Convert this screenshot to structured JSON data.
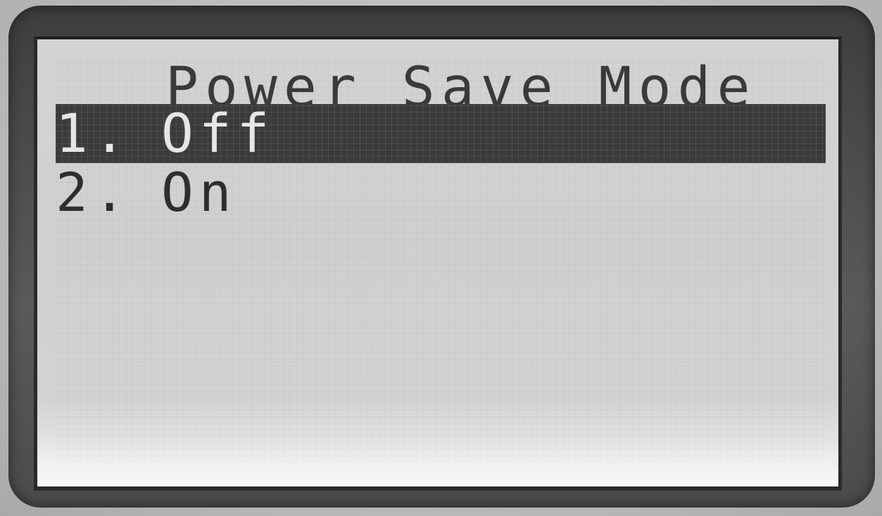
{
  "screen": {
    "title": "Power Save Mode",
    "menu": {
      "items": [
        {
          "number": "1.",
          "label": "Off",
          "selected": true
        },
        {
          "number": "2.",
          "label": "On",
          "selected": false
        }
      ]
    }
  },
  "colors": {
    "lcd_background": "#d2d2d2",
    "lcd_text": "#2e2e2e",
    "selection_bar": "#3b3b3b",
    "bezel": "#4a4a4a"
  }
}
